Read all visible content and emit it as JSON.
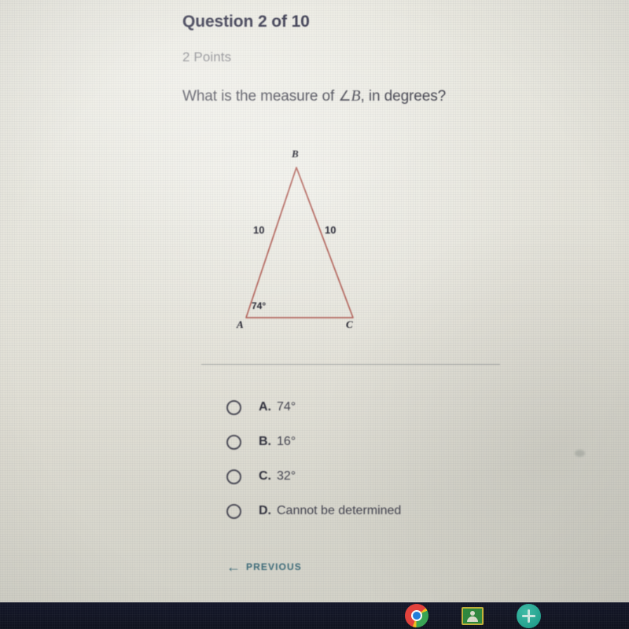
{
  "quiz": {
    "title": "Question 2 of 10",
    "points": "2 Points",
    "prompt_before": "What is the measure of ",
    "prompt_angle_symbol": "∠",
    "prompt_angle_vertex": "B",
    "prompt_after": ", in degrees?"
  },
  "figure": {
    "type": "isosceles-triangle",
    "vertex_labels": {
      "apex": "B",
      "bottom_left": "A",
      "bottom_right": "C"
    },
    "side_labels": {
      "left": "10",
      "right": "10"
    },
    "angle_labels": {
      "at_a": "74°"
    },
    "stroke_color": "#b5655c",
    "label_color": "#1c1c28"
  },
  "options": [
    {
      "letter": "A.",
      "text": "74°",
      "selected": false
    },
    {
      "letter": "B.",
      "text": "16°",
      "selected": false
    },
    {
      "letter": "C.",
      "text": "32°",
      "selected": false
    },
    {
      "letter": "D.",
      "text": "Cannot be determined",
      "selected": false
    }
  ],
  "navigation": {
    "previous_label": "PREVIOUS",
    "previous_arrow": "←",
    "accent_color": "#3b6a78"
  },
  "taskbar": {
    "background": "#121524",
    "icons": [
      {
        "name": "chrome-icon",
        "label": "Google Chrome"
      },
      {
        "name": "google-classroom-icon",
        "label": "Google Classroom"
      },
      {
        "name": "add-icon",
        "label": "New"
      }
    ]
  }
}
